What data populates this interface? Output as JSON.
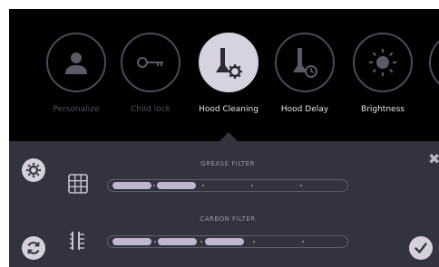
{
  "modes": [
    {
      "label": "Personalize",
      "icon": "person-icon",
      "state": "inactive"
    },
    {
      "label": "Child lock",
      "icon": "key-icon",
      "state": "inactive"
    },
    {
      "label": "Hood Cleaning",
      "icon": "hood-cleaning-icon",
      "state": "selected"
    },
    {
      "label": "Hood Delay",
      "icon": "hood-delay-icon",
      "state": "inactive"
    },
    {
      "label": "Brightness",
      "icon": "sun-icon",
      "state": "inactive"
    }
  ],
  "panel": {
    "grease_filter": {
      "title": "GREASE FILTER",
      "segments_filled": 2,
      "segments_total": 6
    },
    "carbon_filter": {
      "title": "CARBON FILTER",
      "segments_filled": 3,
      "segments_total": 6
    }
  },
  "controls": {
    "settings_icon": "gear-icon",
    "reset_icon": "refresh-icon",
    "close_icon": "close-icon",
    "confirm_icon": "checkmark-icon"
  },
  "colors": {
    "background": "#010101",
    "panel": "#32333f",
    "accent": "#d6d2e0",
    "inactive": "#5a5b68"
  }
}
